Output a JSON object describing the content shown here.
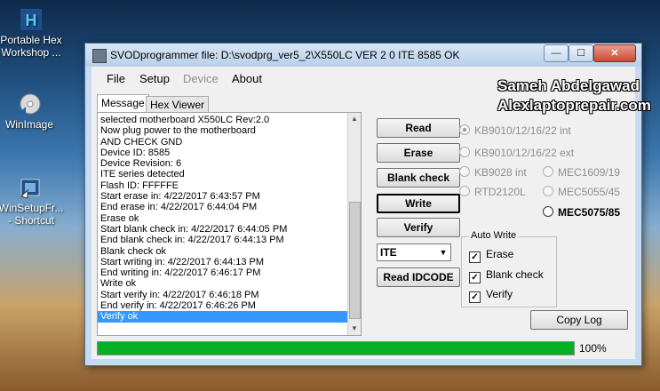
{
  "desktop": {
    "icons": [
      {
        "label_line1": "Portable Hex",
        "label_line2": "Workshop ...",
        "icon": "hex-workshop-icon"
      },
      {
        "label_line1": "WinImage",
        "label_line2": "",
        "icon": "winimage-icon"
      },
      {
        "label_line1": "WinSetupFr...",
        "label_line2": "- Shortcut",
        "icon": "winsetup-icon"
      }
    ]
  },
  "window": {
    "title": "SVODprogrammer file: D:\\svodprg_ver5_2\\X550LC VER 2 0 ITE 8585 OK",
    "close_glyph": "✕",
    "min_glyph": "—",
    "max_glyph": "☐"
  },
  "menu": [
    "File",
    "Setup",
    "Device",
    "About"
  ],
  "tabs": [
    "Message",
    "Hex Viewer"
  ],
  "log": {
    "lines": [
      "selected motherboard X550LC Rev:2.0",
      "Now plug power to the motherboard",
      "AND CHECK GND",
      "Device ID: 8585",
      "Device Revision: 6",
      "ITE series detected",
      "Flash ID: FFFFFE",
      "Start erase in: 4/22/2017 6:43:57 PM",
      "End erase in: 4/22/2017 6:44:04 PM",
      "Erase ok",
      "Start blank check in: 4/22/2017 6:44:05 PM",
      "End blank check in: 4/22/2017 6:44:13 PM",
      "Blank check ok",
      "Start writing in: 4/22/2017 6:44:13 PM",
      "End writing in: 4/22/2017 6:46:17 PM",
      "Write ok",
      "Start verify in: 4/22/2017 6:46:18 PM",
      "End verify in: 4/22/2017 6:46:26 PM",
      "Verify ok"
    ],
    "selected_index": 18
  },
  "buttons": {
    "read": "Read",
    "erase": "Erase",
    "blank_check": "Blank check",
    "write": "Write",
    "verify": "Verify",
    "read_idcode": "Read IDCODE",
    "copy_log": "Copy Log"
  },
  "chip_select": {
    "value": "ITE",
    "arrow": "▼"
  },
  "radios": {
    "kb9010_int": "KB9010/12/16/22 int",
    "kb9010_ext": "KB9010/12/16/22 ext",
    "kb9028_int": "KB9028 int",
    "mec1609": "MEC1609/19",
    "rtd2120l": "RTD2120L",
    "mec5055": "MEC5055/45",
    "mec5075": "MEC5075/85"
  },
  "auto_write": {
    "legend": "Auto Write",
    "erase": "Erase",
    "blank_check": "Blank check",
    "verify": "Verify",
    "checkmark": "✓"
  },
  "progress": {
    "value": 1.0,
    "label": "100%"
  },
  "watermark": {
    "line1": "Sameh Abdelgawad",
    "line2": "Alexlaptoprepair.com"
  },
  "colors": {
    "progress_fill": "#06b025",
    "selection": "#3399ff"
  }
}
